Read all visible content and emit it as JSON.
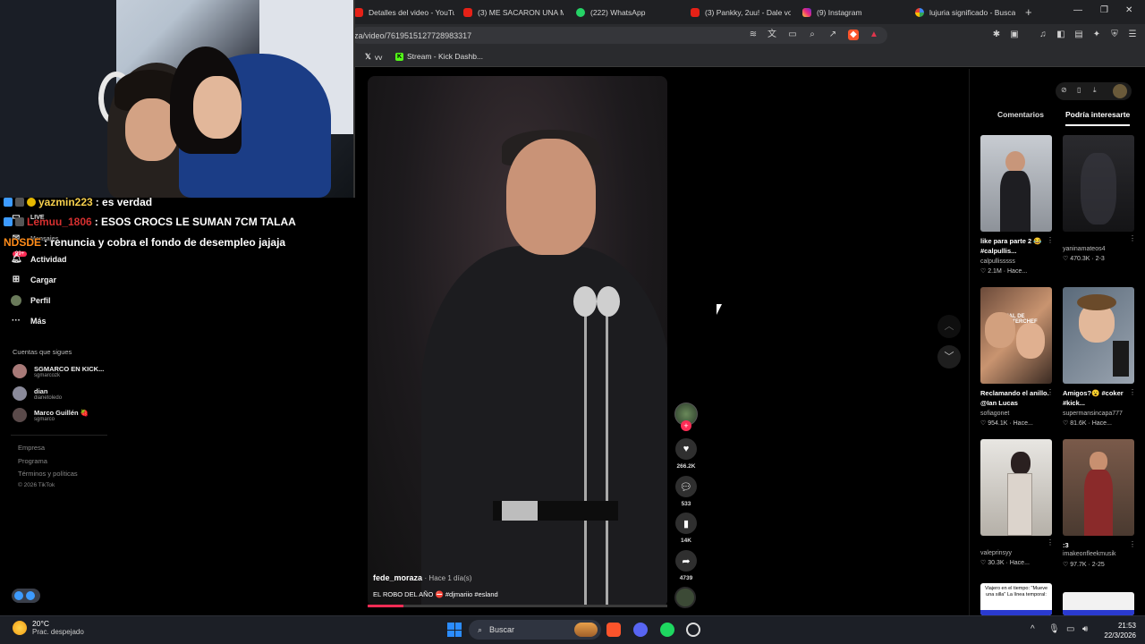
{
  "browser": {
    "tabs": [
      {
        "title": "Detalles del video - YouTu",
        "icon": "youtube-icon"
      },
      {
        "title": "(3) ME SACARON UNA M",
        "icon": "youtube-icon"
      },
      {
        "title": "(222) WhatsApp",
        "icon": "whatsapp-icon"
      },
      {
        "title": "(3) Pankky, 2uu! - Dale vol",
        "icon": "youtube-icon"
      },
      {
        "title": "(9) Instagram",
        "icon": "instagram-icon"
      },
      {
        "title": "lujuria significado - Busca",
        "icon": "google-icon"
      }
    ],
    "url": "za/video/7619515127728983317",
    "bookmarks": [
      {
        "label": "vv",
        "icon": "x-icon"
      },
      {
        "label": "Stream - Kick Dashb...",
        "icon": "kick-icon"
      }
    ]
  },
  "stream_chat": [
    {
      "user": "yazmin223",
      "message": ": es verdad",
      "user_color": "#f6d04d"
    },
    {
      "user": "Lemuu_1806",
      "message": ": ESOS CROCS LE SUMAN 7CM TALAA",
      "user_color": "#d63030"
    },
    {
      "user": "NDSDE",
      "message": ": renuncia y cobra el fondo de desempleo jajaja",
      "user_color": "#ff8c1a"
    }
  ],
  "tiktok_nav": {
    "live_label": "LIVE",
    "messages_label": "Mensajes",
    "notif_badge": "99+",
    "items": [
      {
        "label": "Actividad",
        "icon": "bell-icon"
      },
      {
        "label": "Cargar",
        "icon": "plus-square-icon"
      },
      {
        "label": "Perfil",
        "icon": "profile-icon"
      },
      {
        "label": "Más",
        "icon": "more-icon"
      }
    ],
    "following_title": "Cuentas que sigues",
    "following": [
      {
        "name": "SGMARCO EN KICK...",
        "handle": "sgmarcozk"
      },
      {
        "name": "dian",
        "handle": "dianetoledo"
      },
      {
        "name": "Marco Guillén 🍓",
        "handle": "sgmarco"
      }
    ],
    "footer": [
      "Empresa",
      "Programa",
      "Términos y políticas",
      "© 2026 TikTok"
    ]
  },
  "video": {
    "username": "fede_moraza",
    "time_ago": "· Hace 1 día(s)",
    "caption": "EL ROBO DEL AÑO ⛔ #djmariio #esland",
    "progress": 0.12
  },
  "actions": [
    {
      "icon": "heart-icon",
      "count": "266.2K"
    },
    {
      "icon": "comment-icon",
      "count": "533"
    },
    {
      "icon": "bookmark-icon",
      "count": "14K"
    },
    {
      "icon": "share-icon",
      "count": "4739"
    }
  ],
  "right_panel": {
    "tabs": [
      "Comentarios",
      "Podría interesarte"
    ],
    "thumbs": [
      {
        "caption": "like para parte 2 😂 #calpullis...",
        "user": "calpullisssss",
        "stats": "♡ 2.1M · Hace..."
      },
      {
        "caption": "",
        "user": "yaninamateos4",
        "stats": "♡ 470.3K · 2-3"
      },
      {
        "caption": "Reclamando el anillo. @Ian Lucas",
        "user": "sofiagonet",
        "stats": "♡ 954.1K · Hace..."
      },
      {
        "caption": "Amigos?😮 #coker #kick...",
        "user": "supermansincapa777",
        "stats": "♡ 81.6K · Hace..."
      },
      {
        "caption": "",
        "user": "valeprinsyy",
        "stats": "♡ 30.3K · Hace..."
      },
      {
        "caption": ":3",
        "user": "imakeonfleekmusik",
        "stats": "♡ 97.7K · 2-25"
      }
    ],
    "thumb_overlay_text": "FINAL DE MASTERCHEF",
    "bottom_thumb_text": "Viajero en el tiempo: \"Mueve una silla\" La línea temporal:"
  },
  "taskbar": {
    "temp": "20°C",
    "weather": "Prac. despejado",
    "search_placeholder": "Buscar",
    "time": "21:53",
    "date": "22/3/2026"
  }
}
